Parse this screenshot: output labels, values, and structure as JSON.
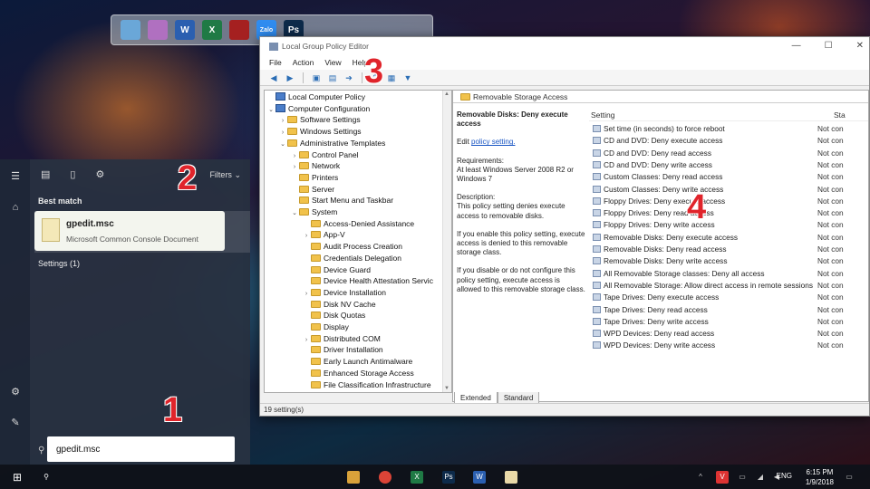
{
  "dock": {
    "icons": [
      {
        "name": "monitor-icon",
        "color": "#6aa7d8"
      },
      {
        "name": "recycle-bin-icon",
        "color": "#b070c0"
      },
      {
        "name": "word-icon",
        "color": "#2b5fb0",
        "glyph": "W"
      },
      {
        "name": "excel-icon",
        "color": "#1f7a45",
        "glyph": "X"
      },
      {
        "name": "game-icon",
        "color": "#a52020"
      },
      {
        "name": "zalo-icon",
        "color": "#2f8cf0",
        "glyph": "Zalo"
      },
      {
        "name": "photoshop-icon",
        "color": "#0d2a4a",
        "glyph": "Ps"
      }
    ]
  },
  "start_menu": {
    "filters_label": "Filters",
    "best_match_label": "Best match",
    "best_match_title": "gpedit.msc",
    "best_match_subtitle": "Microsoft Common Console Document",
    "settings_label": "Settings (1)",
    "search_value": "gpedit.msc"
  },
  "window": {
    "title": "Local Group Policy Editor",
    "menu": [
      "File",
      "Action",
      "View",
      "Help"
    ],
    "tree": [
      {
        "label": "Local Computer Policy",
        "indent": 0,
        "icon": "pc",
        "exp": ""
      },
      {
        "label": "Computer Configuration",
        "indent": 0,
        "icon": "pc",
        "exp": "v"
      },
      {
        "label": "Software Settings",
        "indent": 1,
        "icon": "folder",
        "exp": ">"
      },
      {
        "label": "Windows Settings",
        "indent": 1,
        "icon": "folder",
        "exp": ">"
      },
      {
        "label": "Administrative Templates",
        "indent": 1,
        "icon": "folder",
        "exp": "v"
      },
      {
        "label": "Control Panel",
        "indent": 2,
        "icon": "folder",
        "exp": ">"
      },
      {
        "label": "Network",
        "indent": 2,
        "icon": "folder",
        "exp": ">"
      },
      {
        "label": "Printers",
        "indent": 2,
        "icon": "folder",
        "exp": ""
      },
      {
        "label": "Server",
        "indent": 2,
        "icon": "folder",
        "exp": ""
      },
      {
        "label": "Start Menu and Taskbar",
        "indent": 2,
        "icon": "folder",
        "exp": ""
      },
      {
        "label": "System",
        "indent": 2,
        "icon": "folder",
        "exp": "v"
      },
      {
        "label": "Access-Denied Assistance",
        "indent": 3,
        "icon": "folder",
        "exp": ""
      },
      {
        "label": "App-V",
        "indent": 3,
        "icon": "folder",
        "exp": ">"
      },
      {
        "label": "Audit Process Creation",
        "indent": 3,
        "icon": "folder",
        "exp": ""
      },
      {
        "label": "Credentials Delegation",
        "indent": 3,
        "icon": "folder",
        "exp": ""
      },
      {
        "label": "Device Guard",
        "indent": 3,
        "icon": "folder",
        "exp": ""
      },
      {
        "label": "Device Health Attestation Servic",
        "indent": 3,
        "icon": "folder",
        "exp": ""
      },
      {
        "label": "Device Installation",
        "indent": 3,
        "icon": "folder",
        "exp": ">"
      },
      {
        "label": "Disk NV Cache",
        "indent": 3,
        "icon": "folder",
        "exp": ""
      },
      {
        "label": "Disk Quotas",
        "indent": 3,
        "icon": "folder",
        "exp": ""
      },
      {
        "label": "Display",
        "indent": 3,
        "icon": "folder",
        "exp": ""
      },
      {
        "label": "Distributed COM",
        "indent": 3,
        "icon": "folder",
        "exp": ">"
      },
      {
        "label": "Driver Installation",
        "indent": 3,
        "icon": "folder",
        "exp": ""
      },
      {
        "label": "Early Launch Antimalware",
        "indent": 3,
        "icon": "folder",
        "exp": ""
      },
      {
        "label": "Enhanced Storage Access",
        "indent": 3,
        "icon": "folder",
        "exp": ""
      },
      {
        "label": "File Classification Infrastructure",
        "indent": 3,
        "icon": "folder",
        "exp": ""
      }
    ],
    "pane_header": "Removable Storage Access",
    "desc": {
      "title": "Removable Disks: Deny execute access",
      "edit_prefix": "Edit",
      "edit_link": "policy setting.",
      "requirements": "Requirements:",
      "requirements_value": "At least Windows Server 2008 R2 or Windows 7",
      "description": "Description:",
      "description_value": "This policy setting denies execute access to removable disks.",
      "enable_text": "If you enable this policy setting, execute access is denied to this removable storage class.",
      "disable_text": "If you disable or do not configure this policy setting, execute access is allowed to this removable storage class."
    },
    "list_header": {
      "setting": "Setting",
      "state": "Sta"
    },
    "settings": [
      {
        "name": "Set time (in seconds) to force reboot",
        "state": "Not con"
      },
      {
        "name": "CD and DVD: Deny execute access",
        "state": "Not con"
      },
      {
        "name": "CD and DVD: Deny read access",
        "state": "Not con"
      },
      {
        "name": "CD and DVD: Deny write access",
        "state": "Not con"
      },
      {
        "name": "Custom Classes: Deny read access",
        "state": "Not con"
      },
      {
        "name": "Custom Classes: Deny write access",
        "state": "Not con"
      },
      {
        "name": "Floppy Drives: Deny execute access",
        "state": "Not con"
      },
      {
        "name": "Floppy Drives: Deny read access",
        "state": "Not con"
      },
      {
        "name": "Floppy Drives: Deny write access",
        "state": "Not con"
      },
      {
        "name": "Removable Disks: Deny execute access",
        "state": "Not con"
      },
      {
        "name": "Removable Disks: Deny read access",
        "state": "Not con"
      },
      {
        "name": "Removable Disks: Deny write access",
        "state": "Not con"
      },
      {
        "name": "All Removable Storage classes: Deny all access",
        "state": "Not con"
      },
      {
        "name": "All Removable Storage: Allow direct access in remote sessions",
        "state": "Not con"
      },
      {
        "name": "Tape Drives: Deny execute access",
        "state": "Not con"
      },
      {
        "name": "Tape Drives: Deny read access",
        "state": "Not con"
      },
      {
        "name": "Tape Drives: Deny write access",
        "state": "Not con"
      },
      {
        "name": "WPD Devices: Deny read access",
        "state": "Not con"
      },
      {
        "name": "WPD Devices: Deny write access",
        "state": "Not con"
      }
    ],
    "selected_index": 9,
    "tabs": [
      "Extended",
      "Standard"
    ],
    "status": "19 setting(s)"
  },
  "annotations": [
    "1",
    "2",
    "3",
    "4"
  ],
  "taskbar": {
    "lang": "ENG",
    "time": "6:15 PM",
    "date": "1/9/2018"
  },
  "colors": {
    "annotation": "#e0242b",
    "link": "#1a56c4"
  }
}
